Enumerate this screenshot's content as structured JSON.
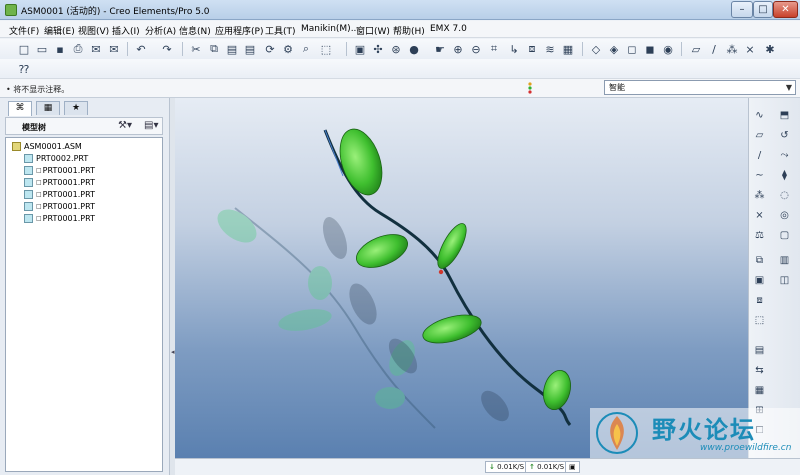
{
  "window": {
    "title": "ASM0001 (活动的) - Creo Elements/Pro 5.0"
  },
  "menubar": [
    "文件(F)",
    "编辑(E)",
    "视图(V)",
    "插入(I)",
    "分析(A)",
    "信息(N)",
    "应用程序(P)",
    "工具(T)",
    "Manikin(M)...",
    "窗口(W)",
    "帮助(H)",
    "EMX 7.0"
  ],
  "message": {
    "text": "• 将不显示注释。"
  },
  "filter": {
    "selected": "智能"
  },
  "model_tree": {
    "header": "模型树",
    "items": [
      {
        "name": "ASM0001.ASM",
        "type": "assembly"
      },
      {
        "name": "PRT0002.PRT",
        "type": "part",
        "mark": ""
      },
      {
        "name": "PRT0001.PRT",
        "type": "part",
        "mark": "□"
      },
      {
        "name": "PRT0001.PRT",
        "type": "part",
        "mark": "□"
      },
      {
        "name": "PRT0001.PRT",
        "type": "part",
        "mark": "□"
      },
      {
        "name": "PRT0001.PRT",
        "type": "part",
        "mark": "□"
      },
      {
        "name": "PRT0001.PRT",
        "type": "part",
        "mark": "□"
      }
    ]
  },
  "status": {
    "download_rate": "0.01K/S",
    "upload_rate": "0.01K/S"
  },
  "watermark": {
    "title": "野火论坛",
    "url": "www.proewildfire.cn"
  },
  "colors": {
    "leaf_green": "#3fbf2f",
    "viewport_top": "#e6ecf4",
    "viewport_bottom": "#5a80b0"
  }
}
